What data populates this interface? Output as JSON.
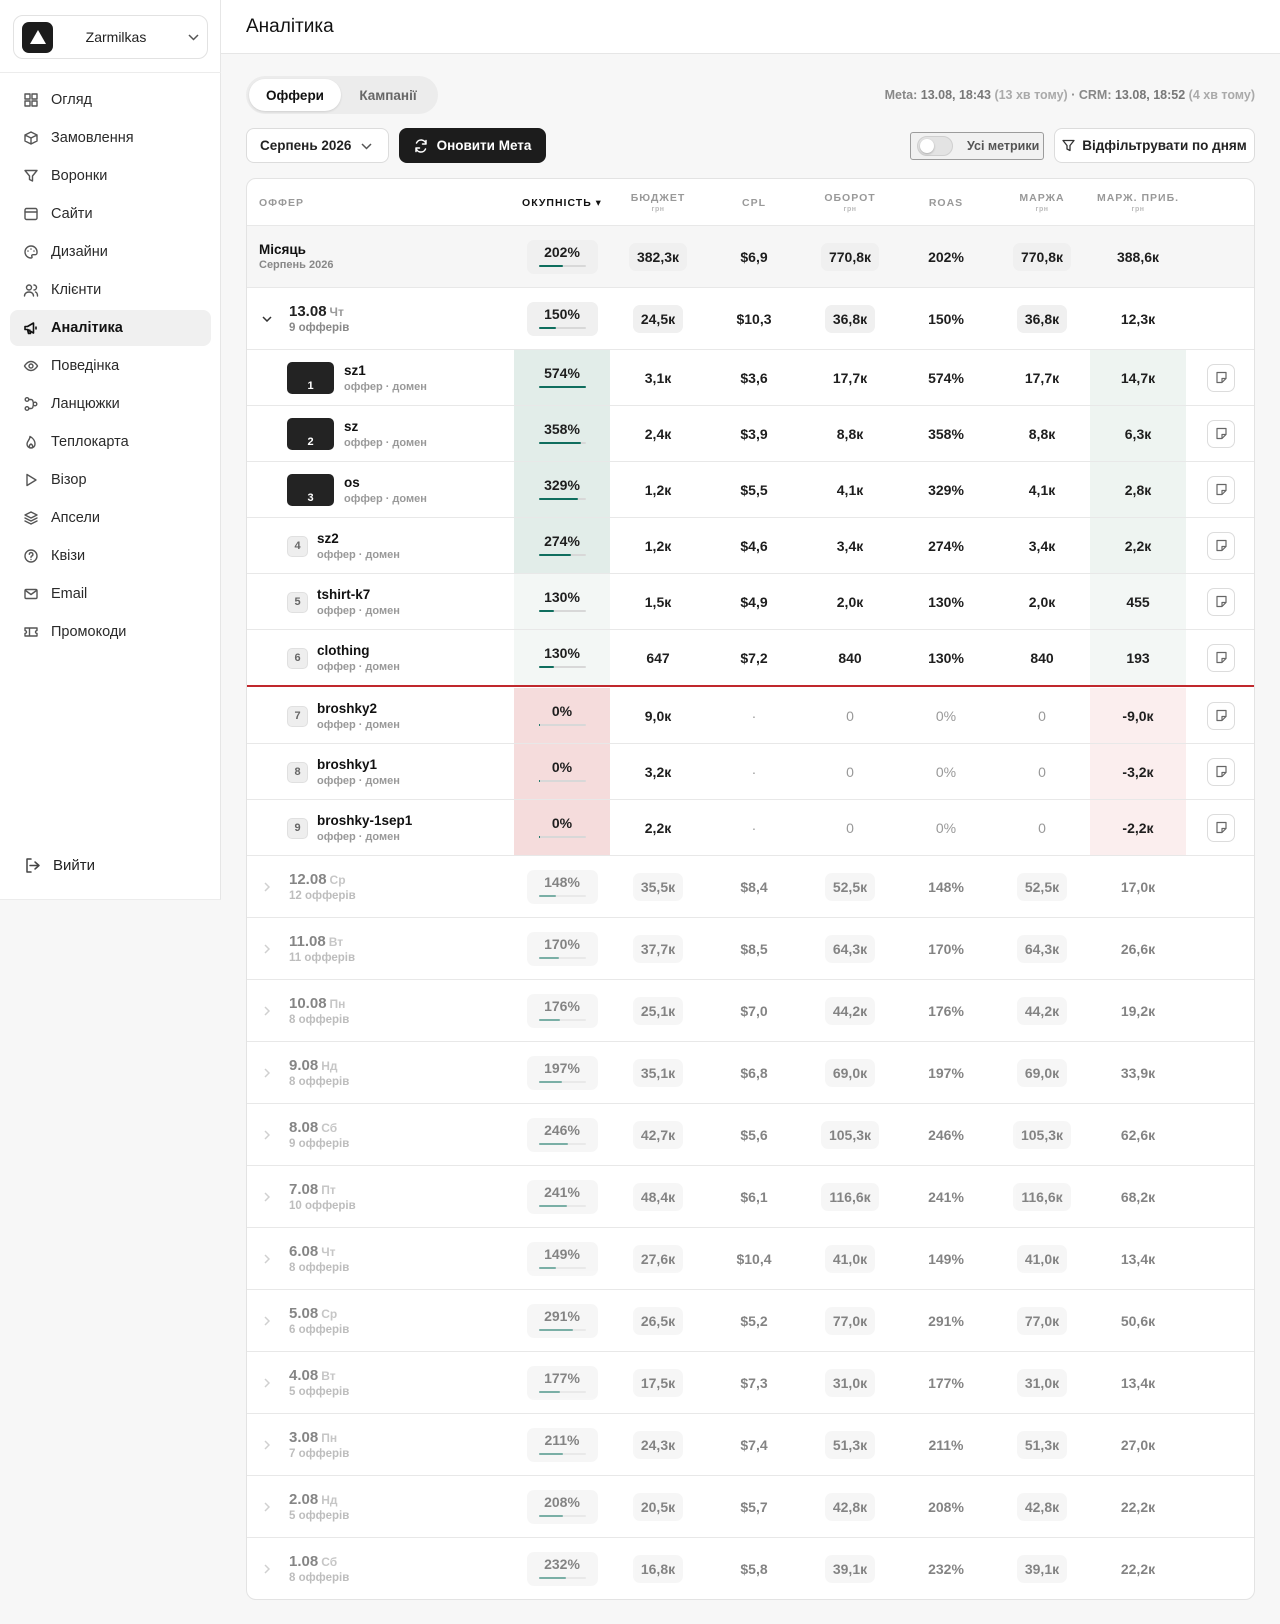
{
  "brand": {
    "name": "Zarmilkas"
  },
  "nav": [
    {
      "label": "Огляд",
      "icon": "grid-icon"
    },
    {
      "label": "Замовлення",
      "icon": "box-icon"
    },
    {
      "label": "Воронки",
      "icon": "funnel-icon"
    },
    {
      "label": "Сайти",
      "icon": "browser-icon"
    },
    {
      "label": "Дизайни",
      "icon": "palette-icon"
    },
    {
      "label": "Клієнти",
      "icon": "users-icon"
    },
    {
      "label": "Аналітика",
      "icon": "megaphone-icon",
      "active": true
    },
    {
      "label": "Поведінка",
      "icon": "eye-icon"
    },
    {
      "label": "Ланцюжки",
      "icon": "chain-icon"
    },
    {
      "label": "Теплокарта",
      "icon": "flame-icon"
    },
    {
      "label": "Візор",
      "icon": "play-icon"
    },
    {
      "label": "Апсели",
      "icon": "layers-icon"
    },
    {
      "label": "Квізи",
      "icon": "help-circle-icon"
    },
    {
      "label": "Email",
      "icon": "mail-icon"
    },
    {
      "label": "Промокоди",
      "icon": "ticket-icon"
    }
  ],
  "logout": "Вийти",
  "header": {
    "title": "Аналітика"
  },
  "tabs": {
    "offers": "Оффери",
    "campaigns": "Кампанії"
  },
  "sync": {
    "meta_label": "Meta:",
    "meta_time": "13.08, 18:43",
    "meta_ago": "(13 хв тому)",
    "sep": "·",
    "crm_label": "CRM:",
    "crm_time": "13.08, 18:52",
    "crm_ago": "(4 хв тому)"
  },
  "toolbar": {
    "month": "Серпень 2026",
    "refresh": "Оновити Мета",
    "all_metrics": "Усі метрики",
    "filter": "Відфільтрувати по дням"
  },
  "columns": {
    "offer": "ОФФЕР",
    "roi": "ОКУПНІСТЬ ▾",
    "budget": "БЮДЖЕТ",
    "cpl": "CPL",
    "turnover": "ОБОРОТ",
    "roas": "ROAS",
    "margin": "МАРЖА",
    "marg_profit": "МАРЖ. ПРИБ.",
    "unit": "грн"
  },
  "summary": {
    "title": "Місяць",
    "subtitle": "Серпень 2026",
    "roi": "202%",
    "roi_fill": 0.5,
    "budget": "382,3к",
    "cpl": "$6,9",
    "turnover": "770,8к",
    "roas": "202%",
    "margin": "770,8к",
    "profit": "388,6к"
  },
  "expanded_day": {
    "date": "13.08",
    "weekday": "Чт",
    "count": "9 офферів",
    "roi": "150%",
    "roi_fill": 0.37,
    "budget": "24,5к",
    "cpl": "$10,3",
    "turnover": "36,8к",
    "roas": "150%",
    "margin": "36,8к",
    "profit": "12,3к"
  },
  "offers": [
    {
      "rank": "1",
      "name": "sz1",
      "sub": "оффер · домен",
      "roi": "574%",
      "roi_fill": 1.0,
      "budget": "3,1к",
      "cpl": "$3,6",
      "turnover": "17,7к",
      "roas": "574%",
      "margin": "17,7к",
      "profit": "14,7к",
      "tone": "good",
      "top": true
    },
    {
      "rank": "2",
      "name": "sz",
      "sub": "оффер · домен",
      "roi": "358%",
      "roi_fill": 0.9,
      "budget": "2,4к",
      "cpl": "$3,9",
      "turnover": "8,8к",
      "roas": "358%",
      "margin": "8,8к",
      "profit": "6,3к",
      "tone": "good",
      "top": true
    },
    {
      "rank": "3",
      "name": "os",
      "sub": "оффер · домен",
      "roi": "329%",
      "roi_fill": 0.82,
      "budget": "1,2к",
      "cpl": "$5,5",
      "turnover": "4,1к",
      "roas": "329%",
      "margin": "4,1к",
      "profit": "2,8к",
      "tone": "good",
      "top": true
    },
    {
      "rank": "4",
      "name": "sz2",
      "sub": "оффер · домен",
      "roi": "274%",
      "roi_fill": 0.68,
      "budget": "1,2к",
      "cpl": "$4,6",
      "turnover": "3,4к",
      "roas": "274%",
      "margin": "3,4к",
      "profit": "2,2к",
      "tone": "good"
    },
    {
      "rank": "5",
      "name": "tshirt-k7",
      "sub": "оффер · домен",
      "roi": "130%",
      "roi_fill": 0.32,
      "budget": "1,5к",
      "cpl": "$4,9",
      "turnover": "2,0к",
      "roas": "130%",
      "margin": "2,0к",
      "profit": "455",
      "tone": "light"
    },
    {
      "rank": "6",
      "name": "clothing",
      "sub": "оффер · домен",
      "roi": "130%",
      "roi_fill": 0.32,
      "budget": "647",
      "cpl": "$7,2",
      "turnover": "840",
      "roas": "130%",
      "margin": "840",
      "profit": "193",
      "tone": "light"
    },
    {
      "rank": "7",
      "name": "broshky2",
      "sub": "оффер · домен",
      "roi": "0%",
      "roi_fill": 0.02,
      "budget": "9,0к",
      "cpl": "·",
      "turnover": "0",
      "roas": "0%",
      "margin": "0",
      "profit": "-9,0к",
      "tone": "bad"
    },
    {
      "rank": "8",
      "name": "broshky1",
      "sub": "оффер · домен",
      "roi": "0%",
      "roi_fill": 0.02,
      "budget": "3,2к",
      "cpl": "·",
      "turnover": "0",
      "roas": "0%",
      "margin": "0",
      "profit": "-3,2к",
      "tone": "bad"
    },
    {
      "rank": "9",
      "name": "broshky-1sep1",
      "sub": "оффер · домен",
      "roi": "0%",
      "roi_fill": 0.02,
      "budget": "2,2к",
      "cpl": "·",
      "turnover": "0",
      "roas": "0%",
      "margin": "0",
      "profit": "-2,2к",
      "tone": "bad"
    }
  ],
  "days": [
    {
      "date": "12.08",
      "weekday": "Ср",
      "count": "12 офферів",
      "roi": "148%",
      "roi_fill": 0.37,
      "budget": "35,5к",
      "cpl": "$8,4",
      "turnover": "52,5к",
      "roas": "148%",
      "margin": "52,5к",
      "profit": "17,0к"
    },
    {
      "date": "11.08",
      "weekday": "Вт",
      "count": "11 офферів",
      "roi": "170%",
      "roi_fill": 0.42,
      "budget": "37,7к",
      "cpl": "$8,5",
      "turnover": "64,3к",
      "roas": "170%",
      "margin": "64,3к",
      "profit": "26,6к"
    },
    {
      "date": "10.08",
      "weekday": "Пн",
      "count": "8 офферів",
      "roi": "176%",
      "roi_fill": 0.44,
      "budget": "25,1к",
      "cpl": "$7,0",
      "turnover": "44,2к",
      "roas": "176%",
      "margin": "44,2к",
      "profit": "19,2к"
    },
    {
      "date": "9.08",
      "weekday": "Нд",
      "count": "8 офферів",
      "roi": "197%",
      "roi_fill": 0.49,
      "budget": "35,1к",
      "cpl": "$6,8",
      "turnover": "69,0к",
      "roas": "197%",
      "margin": "69,0к",
      "profit": "33,9к"
    },
    {
      "date": "8.08",
      "weekday": "Сб",
      "count": "9 офферів",
      "roi": "246%",
      "roi_fill": 0.61,
      "budget": "42,7к",
      "cpl": "$5,6",
      "turnover": "105,3к",
      "roas": "246%",
      "margin": "105,3к",
      "profit": "62,6к"
    },
    {
      "date": "7.08",
      "weekday": "Пт",
      "count": "10 офферів",
      "roi": "241%",
      "roi_fill": 0.6,
      "budget": "48,4к",
      "cpl": "$6,1",
      "turnover": "116,6к",
      "roas": "241%",
      "margin": "116,6к",
      "profit": "68,2к"
    },
    {
      "date": "6.08",
      "weekday": "Чт",
      "count": "8 офферів",
      "roi": "149%",
      "roi_fill": 0.37,
      "budget": "27,6к",
      "cpl": "$10,4",
      "turnover": "41,0к",
      "roas": "149%",
      "margin": "41,0к",
      "profit": "13,4к"
    },
    {
      "date": "5.08",
      "weekday": "Ср",
      "count": "6 офферів",
      "roi": "291%",
      "roi_fill": 0.72,
      "budget": "26,5к",
      "cpl": "$5,2",
      "turnover": "77,0к",
      "roas": "291%",
      "margin": "77,0к",
      "profit": "50,6к"
    },
    {
      "date": "4.08",
      "weekday": "Вт",
      "count": "5 офферів",
      "roi": "177%",
      "roi_fill": 0.44,
      "budget": "17,5к",
      "cpl": "$7,3",
      "turnover": "31,0к",
      "roas": "177%",
      "margin": "31,0к",
      "profit": "13,4к"
    },
    {
      "date": "3.08",
      "weekday": "Пн",
      "count": "7 офферів",
      "roi": "211%",
      "roi_fill": 0.52,
      "budget": "24,3к",
      "cpl": "$7,4",
      "turnover": "51,3к",
      "roas": "211%",
      "margin": "51,3к",
      "profit": "27,0к"
    },
    {
      "date": "2.08",
      "weekday": "Нд",
      "count": "5 офферів",
      "roi": "208%",
      "roi_fill": 0.52,
      "budget": "20,5к",
      "cpl": "$5,7",
      "turnover": "42,8к",
      "roas": "208%",
      "margin": "42,8к",
      "profit": "22,2к"
    },
    {
      "date": "1.08",
      "weekday": "Сб",
      "count": "8 офферів",
      "roi": "232%",
      "roi_fill": 0.57,
      "budget": "16,8к",
      "cpl": "$5,8",
      "turnover": "39,1к",
      "roas": "232%",
      "margin": "39,1к",
      "profit": "22,2к"
    }
  ],
  "colors": {
    "accent": "#0f6e5e",
    "good_bg": "#e2ede9",
    "light_bg": "#f3f7f5",
    "bad_bg": "#f5dcdc",
    "bad_profit_bg": "#fbeeee",
    "good_profit_bg": "#eef4f1",
    "divider": "#c0282d",
    "dark": "#1c1c1c"
  }
}
